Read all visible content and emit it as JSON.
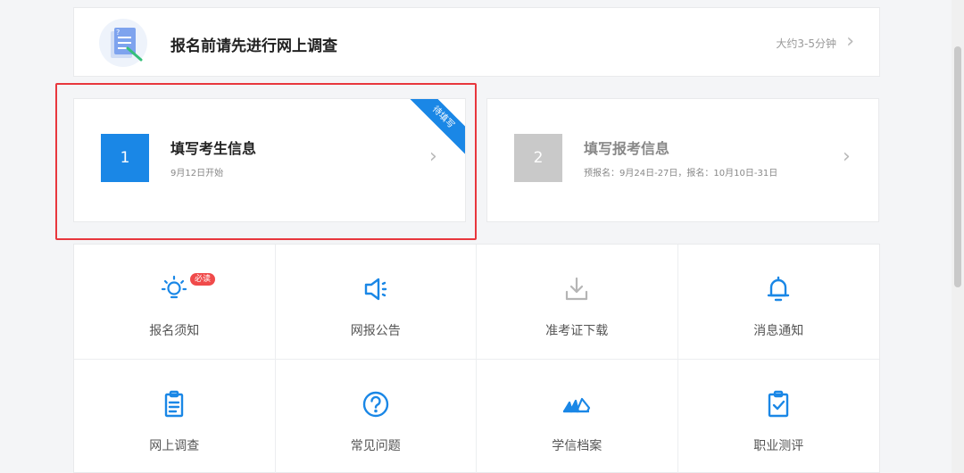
{
  "survey": {
    "title": "报名前请先进行网上调查",
    "meta": "大约3-5分钟"
  },
  "steps": [
    {
      "number": "1",
      "title": "填写考生信息",
      "subtitle": "9月12日开始",
      "ribbon": "待填写"
    },
    {
      "number": "2",
      "title": "填写报考信息",
      "subtitle": "预报名：9月24日-27日，报名：10月10日-31日"
    }
  ],
  "tiles": [
    {
      "label": "报名须知",
      "icon": "lightbulb-icon",
      "badge": "必读"
    },
    {
      "label": "网报公告",
      "icon": "megaphone-icon"
    },
    {
      "label": "准考证下载",
      "icon": "download-icon"
    },
    {
      "label": "消息通知",
      "icon": "bell-icon"
    },
    {
      "label": "网上调查",
      "icon": "clipboard-icon"
    },
    {
      "label": "常见问题",
      "icon": "question-icon"
    },
    {
      "label": "学信档案",
      "icon": "archive-icon"
    },
    {
      "label": "职业测评",
      "icon": "checklist-icon"
    }
  ],
  "colors": {
    "accent": "#1a87e6",
    "disabled": "#c9c9c9",
    "highlight": "#e8373d",
    "badge": "#f04a4a"
  }
}
